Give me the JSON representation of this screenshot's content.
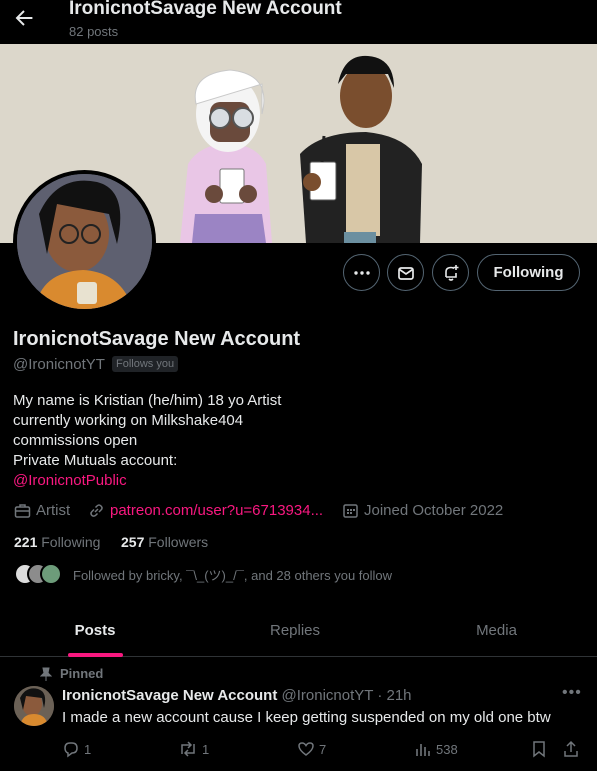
{
  "header": {
    "title": "IronicnotSavage New Account",
    "post_count": "82 posts"
  },
  "profile": {
    "display_name": "IronicnotSavage New Account",
    "handle": "@IronicnotYT",
    "follows_you": "Follows you",
    "bio_lines": [
      "My name is Kristian (he/him) 18 yo Artist",
      "currently working on Milkshake404",
      "commissions open",
      "Private Mutuals account:"
    ],
    "bio_mention": "@IronicnotPublic",
    "category": "Artist",
    "website": "patreon.com/user?u=6713934...",
    "joined": "Joined October 2022",
    "following_count": "221",
    "following_label": "Following",
    "followers_count": "257",
    "followers_label": "Followers",
    "followed_by": "Followed by bricky, ¯\\_(ツ)_/¯, and 28 others you follow"
  },
  "actions": {
    "follow_button": "Following"
  },
  "tabs": [
    "Posts",
    "Replies",
    "Media"
  ],
  "pinned_post": {
    "pinned_label": "Pinned",
    "author_name": "IronicnotSavage New Account",
    "author_handle": "@IronicnotYT · 21h",
    "text": "I made a new account cause I keep getting suspended on my old one btw",
    "replies": "1",
    "reposts": "1",
    "likes": "7",
    "views": "538"
  },
  "colors": {
    "accent": "#f91880",
    "muted": "#71767b",
    "text": "#e7e9ea",
    "background": "#000000"
  }
}
